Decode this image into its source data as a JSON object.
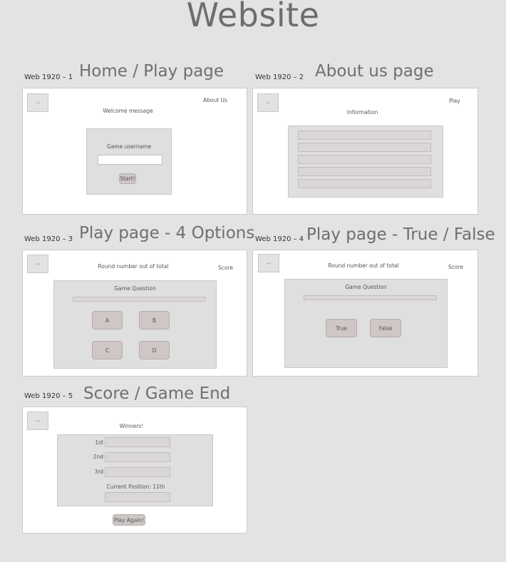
{
  "title": "Website",
  "frames": {
    "f1": {
      "label": "Web 1920 – 1",
      "heading": "Home / Play page",
      "nav": "About Us",
      "welcome": "Welcome message",
      "username_label": "Game username",
      "start": "Start!"
    },
    "f2": {
      "label": "Web 1920 – 2",
      "heading": "About us page",
      "nav": "Play",
      "info": "Information"
    },
    "f3": {
      "label": "Web 1920 – 3",
      "heading": "Play page - 4 Options",
      "round": "Round number out of total",
      "score": "Score",
      "question": "Game Question",
      "options": [
        "A",
        "B",
        "C",
        "D"
      ]
    },
    "f4": {
      "label": "Web 1920 – 4",
      "heading": "Play page - True / False",
      "round": "Round number out of total",
      "score": "Score",
      "question": "Game Question",
      "true_label": "True",
      "false_label": "False"
    },
    "f5": {
      "label": "Web 1920 – 5",
      "heading": "Score / Game End",
      "winners": "Winners!",
      "places": [
        "1st",
        "2nd",
        "3rd"
      ],
      "current": "Current Position: 11th",
      "play_again": "Play Again!"
    }
  }
}
